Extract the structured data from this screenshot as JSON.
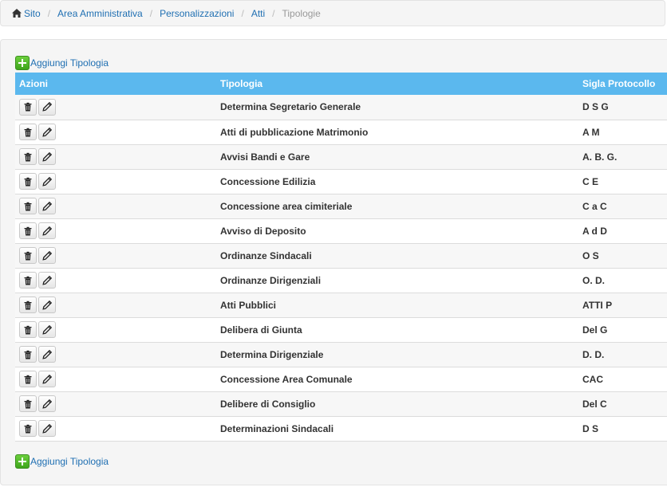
{
  "breadcrumb": {
    "home": "Sito",
    "items": [
      "Area Amministrativa",
      "Personalizzazioni",
      "Atti"
    ],
    "current": "Tipologie"
  },
  "add_label": "Aggiungi Tipologia",
  "table": {
    "headers": {
      "actions": "Azioni",
      "tipologia": "Tipologia",
      "sigla": "Sigla Protocollo"
    },
    "rows": [
      {
        "tipologia": "Determina Segretario Generale",
        "sigla": "D S G"
      },
      {
        "tipologia": "Atti di pubblicazione Matrimonio",
        "sigla": "A M"
      },
      {
        "tipologia": "Avvisi Bandi e Gare",
        "sigla": "A. B. G."
      },
      {
        "tipologia": "Concessione Edilizia",
        "sigla": "C E"
      },
      {
        "tipologia": "Concessione area cimiteriale",
        "sigla": "C a C"
      },
      {
        "tipologia": "Avviso di Deposito",
        "sigla": "A d D"
      },
      {
        "tipologia": "Ordinanze Sindacali",
        "sigla": "O S"
      },
      {
        "tipologia": "Ordinanze Dirigenziali",
        "sigla": "O. D."
      },
      {
        "tipologia": "Atti Pubblici",
        "sigla": "ATTI P"
      },
      {
        "tipologia": "Delibera di Giunta",
        "sigla": "Del G"
      },
      {
        "tipologia": "Determina Dirigenziale",
        "sigla": "D. D."
      },
      {
        "tipologia": "Concessione Area Comunale",
        "sigla": "CAC"
      },
      {
        "tipologia": "Delibere di Consiglio",
        "sigla": "Del C"
      },
      {
        "tipologia": "Determinazioni Sindacali",
        "sigla": "D S"
      }
    ]
  },
  "icons": {
    "home": "home-icon",
    "add": "plus-icon",
    "delete": "trash-icon",
    "edit": "pencil-icon"
  },
  "colors": {
    "header": "#5bb8ee",
    "link": "#1f6fb2",
    "add": "#4cb82a"
  }
}
